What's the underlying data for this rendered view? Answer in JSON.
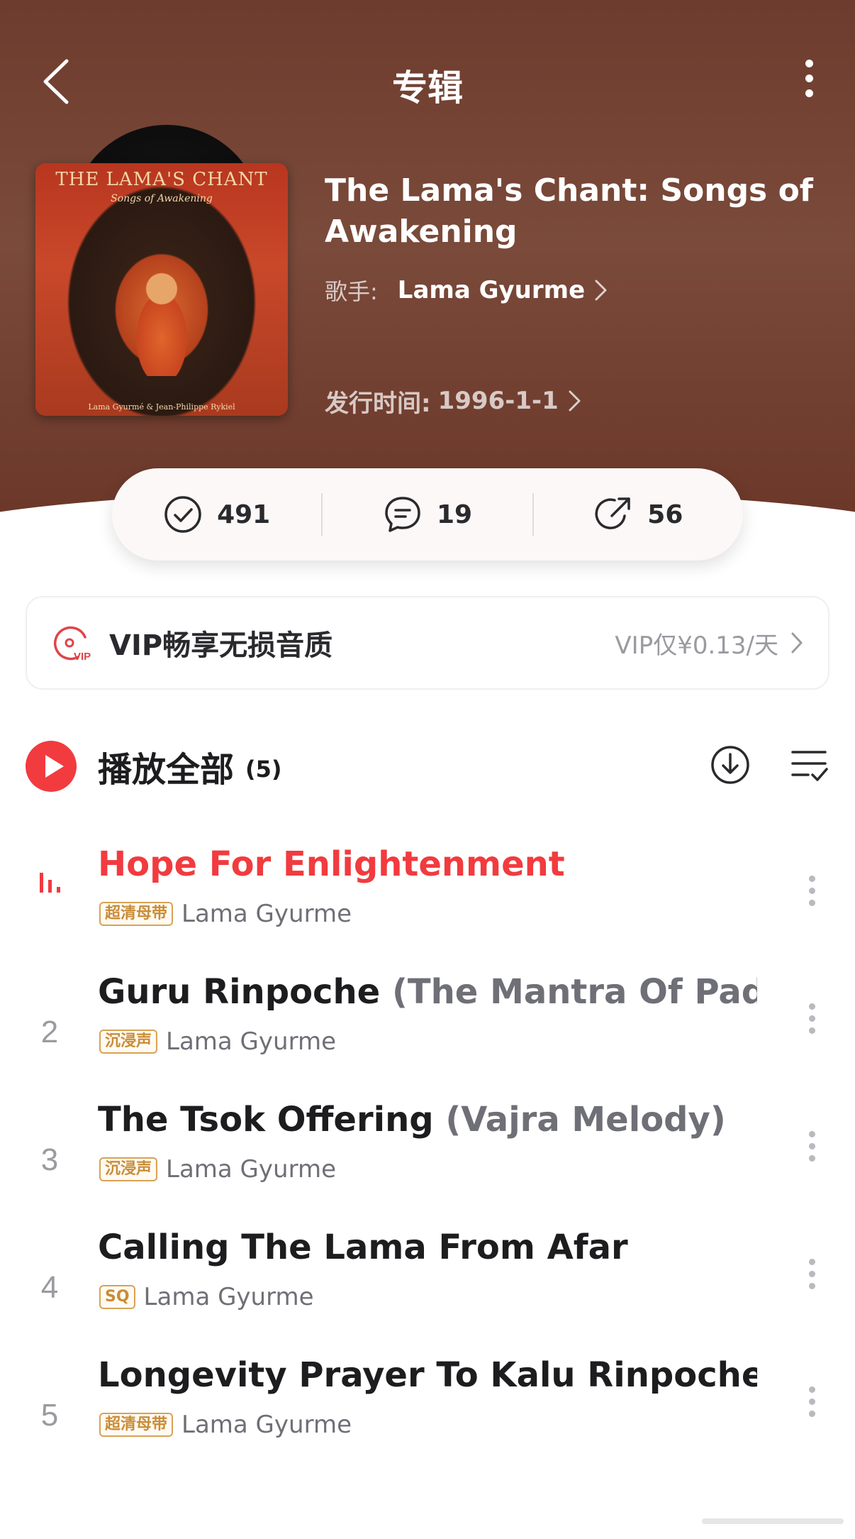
{
  "nav": {
    "title": "专辑"
  },
  "album": {
    "cover_title": "THE LAMA'S CHANT",
    "cover_subtitle": "Songs of Awakening",
    "cover_footer": "Lama Gyurmé & Jean-Philippe Rykiel",
    "title": "The Lama's Chant: Songs of Awakening",
    "artist_label": "歌手:",
    "artist": "Lama Gyurme",
    "release_label": "发行时间:",
    "release_date": "1996-1-1"
  },
  "stats": {
    "collect": "491",
    "comments": "19",
    "shares": "56"
  },
  "vip": {
    "text": "VIP畅享无损音质",
    "price": "VIP仅¥0.13/天"
  },
  "playall": {
    "label": "播放全部",
    "count": "(5)"
  },
  "tracks": [
    {
      "num": "",
      "title": "Hope For Enlightenment",
      "subtitle": "",
      "badge": "超清母带",
      "artist": "Lama Gyurme",
      "playing": true
    },
    {
      "num": "2",
      "title": "Guru Rinpoche",
      "subtitle": " (The Mantra Of Padm...",
      "badge": "沉浸声",
      "artist": "Lama Gyurme",
      "playing": false
    },
    {
      "num": "3",
      "title": "The Tsok Offering",
      "subtitle": " (Vajra Melody)",
      "badge": "沉浸声",
      "artist": "Lama Gyurme",
      "playing": false
    },
    {
      "num": "4",
      "title": "Calling The Lama From Afar",
      "subtitle": "",
      "badge": "SQ",
      "artist": "Lama Gyurme",
      "playing": false
    },
    {
      "num": "5",
      "title": "Longevity Prayer To Kalu Rinpoche",
      "subtitle": "",
      "badge": "超清母带",
      "artist": "Lama Gyurme",
      "playing": false
    }
  ],
  "colors": {
    "accent": "#f13b3f",
    "header_brown": "#7a4a3a",
    "badge_gold": "#c98c37"
  }
}
